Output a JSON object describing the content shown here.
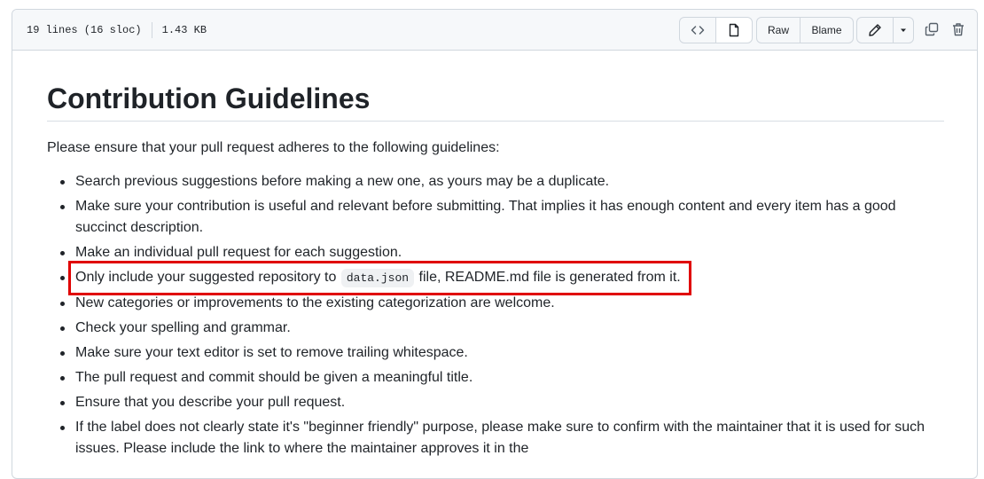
{
  "header": {
    "lines_info": "19 lines (16 sloc)",
    "size": "1.43 KB",
    "raw_label": "Raw",
    "blame_label": "Blame",
    "icons": [
      "code-icon",
      "file-icon",
      "pencil-icon",
      "triangle-down-icon",
      "copy-icon",
      "trash-icon"
    ]
  },
  "content": {
    "title": "Contribution Guidelines",
    "intro": "Please ensure that your pull request adheres to the following guidelines:",
    "items": [
      "Search previous suggestions before making a new one, as yours may be a duplicate.",
      "Make sure your contribution is useful and relevant before submitting. That implies it has enough content and every item has a good succinct description.",
      "Make an individual pull request for each suggestion.",
      {
        "before": "Only include your suggested repository to",
        "code": "data.json",
        "after": "file, README.md file is generated from it."
      },
      "New categories or improvements to the existing categorization are welcome.",
      "Check your spelling and grammar.",
      "Make sure your text editor is set to remove trailing whitespace.",
      "The pull request and commit should be given a meaningful title.",
      "Ensure that you describe your pull request.",
      "If the label does not clearly state it's \"beginner friendly\" purpose, please make sure to confirm with the maintainer that it is used for such issues. Please include the link to where the maintainer approves it in the"
    ]
  },
  "colors": {
    "highlight": "#e00000",
    "header_bg": "#f6f8fa",
    "border": "#d0d7de"
  }
}
